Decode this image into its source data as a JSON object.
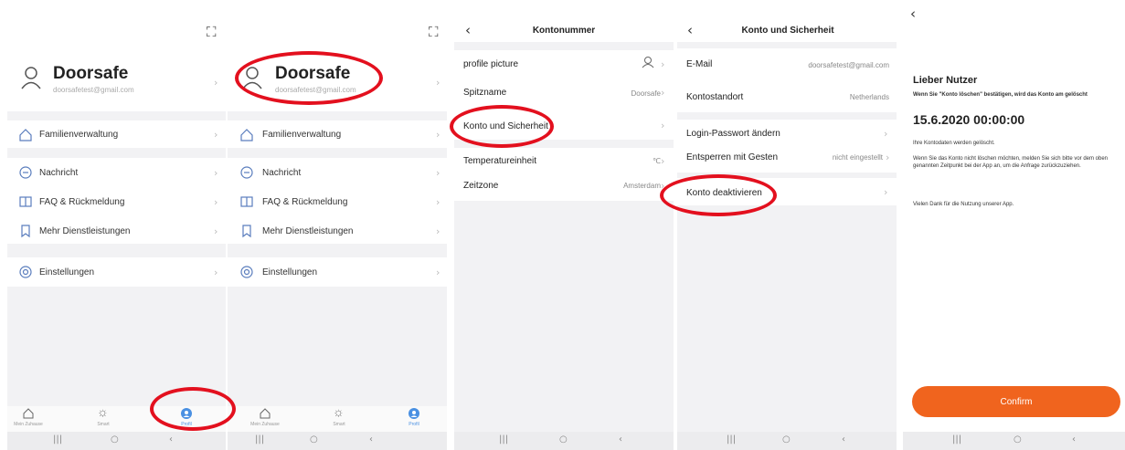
{
  "panel1": {
    "profile": {
      "name": "Doorsafe",
      "email": "doorsafetest@gmail.com"
    },
    "menu": {
      "family": "Familienverwaltung",
      "message": "Nachricht",
      "faq": "FAQ & Rückmeldung",
      "more": "Mehr Dienstleistungen",
      "settings": "Einstellungen"
    },
    "nav": {
      "home": "Mein Zuhause",
      "smart": "Smart",
      "profile": "Profil"
    }
  },
  "panel2": {
    "profile": {
      "name": "Doorsafe",
      "email": "doorsafetest@gmail.com"
    },
    "menu": {
      "family": "Familienverwaltung",
      "message": "Nachricht",
      "faq": "FAQ & Rückmeldung",
      "more": "Mehr Dienstleistungen",
      "settings": "Einstellungen"
    },
    "nav": {
      "home": "Mein Zuhause",
      "smart": "Smart",
      "profile": "Profil"
    }
  },
  "panel3": {
    "title": "Kontonummer",
    "rows": {
      "picture": "profile picture",
      "nickname": "Spitzname",
      "nickname_value": "Doorsafe",
      "account": "Konto und Sicherheit",
      "temperature": "Temperatureinheit",
      "temperature_value": "℃",
      "timezone": "Zeitzone",
      "timezone_value": "Amsterdam"
    }
  },
  "panel4": {
    "title": "Konto und Sicherheit",
    "rows": {
      "email": "E-Mail",
      "email_value": "doorsafetest@gmail.com",
      "location": "Kontostandort",
      "location_value": "Netherlands",
      "password": "Login-Passwort ändern",
      "gesture": "Entsperren mit Gesten",
      "gesture_value": "nicht eingestellt",
      "deactivate": "Konto deaktivieren"
    }
  },
  "panel5": {
    "heading": "Lieber Nutzer",
    "notice": "Wenn Sie \"Konto löschen\" bestätigen, wird das Konto am gelöscht",
    "date": "15.6.2020 00:00:00",
    "info1": "Ihre Kontodaten werden gelöscht.",
    "info2": "Wenn Sie das Konto nicht löschen möchten, melden Sie sich bitte vor dem oben genannten Zeitpunkt bei der App an, um die Anfrage zurückzuziehen.",
    "thanks": "Vielen Dank für die Nutzung unserer App.",
    "confirm": "Confirm"
  },
  "colors": {
    "accent": "#f0641e",
    "highlight": "#e3101e",
    "nav_active": "#4a90e2"
  },
  "icons": [
    "scan-icon",
    "user-icon",
    "home-icon",
    "message-icon",
    "book-icon",
    "bookmark-icon",
    "settings-icon",
    "sun-icon",
    "back-icon",
    "chevron-right-icon"
  ]
}
